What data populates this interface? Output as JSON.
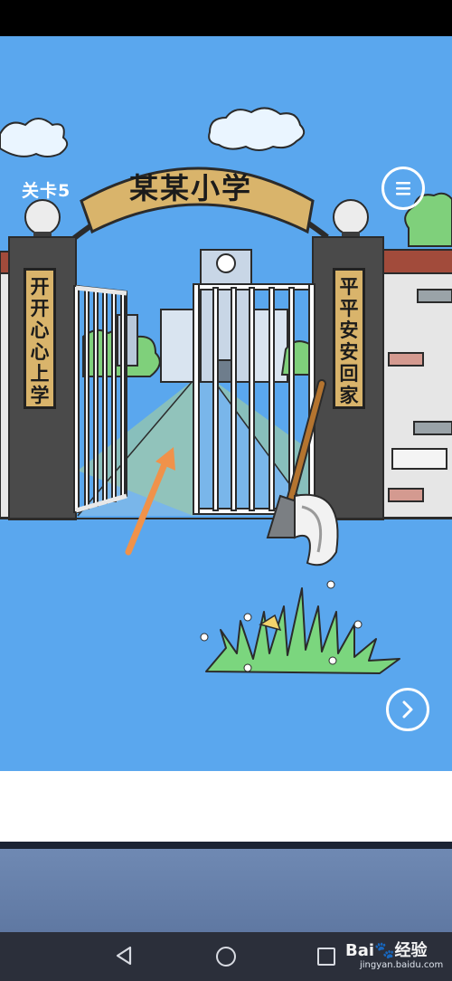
{
  "game": {
    "level_label": "关卡5",
    "arch_sign": "某某小学",
    "left_banner": "开开心心上学",
    "right_banner": "平平安安回家"
  },
  "icons": {
    "menu": "menu-icon",
    "next": "chevron-right-icon",
    "axe": "axe-icon",
    "arrow": "arrow-hint-icon"
  },
  "nav": {
    "back": "back-triangle-icon",
    "home": "home-circle-icon",
    "recent": "recent-square-icon"
  },
  "watermark": {
    "brand": "Bai",
    "suffix": "经验",
    "url": "jingyan.baidu.com"
  },
  "colors": {
    "sky": "#5aa7ee",
    "gate_sign": "#d9b46b",
    "arrow": "#f0924a",
    "grass": "#7bd67e"
  }
}
